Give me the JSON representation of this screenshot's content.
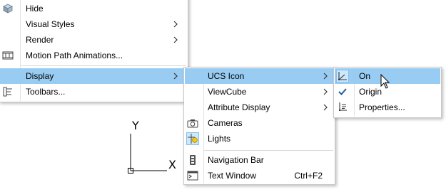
{
  "main_menu": {
    "items": [
      {
        "label": "Hide"
      },
      {
        "label": "Visual Styles"
      },
      {
        "label": "Render"
      },
      {
        "label": "Motion Path Animations..."
      },
      {
        "label": "Display"
      },
      {
        "label": "Toolbars..."
      }
    ]
  },
  "display_menu": {
    "items": [
      {
        "label": "UCS Icon"
      },
      {
        "label": "ViewCube"
      },
      {
        "label": "Attribute Display"
      },
      {
        "label": "Cameras"
      },
      {
        "label": "Lights"
      },
      {
        "label": "Navigation Bar"
      },
      {
        "label": "Text Window",
        "shortcut": "Ctrl+F2"
      }
    ]
  },
  "ucs_menu": {
    "items": [
      {
        "label": "On"
      },
      {
        "label": "Origin"
      },
      {
        "label": "Properties..."
      }
    ]
  },
  "ucs_icon": {
    "y_label": "Y",
    "x_label": "X"
  },
  "colors": {
    "highlight": "#99ccf3",
    "border": "#c8c8c8"
  }
}
